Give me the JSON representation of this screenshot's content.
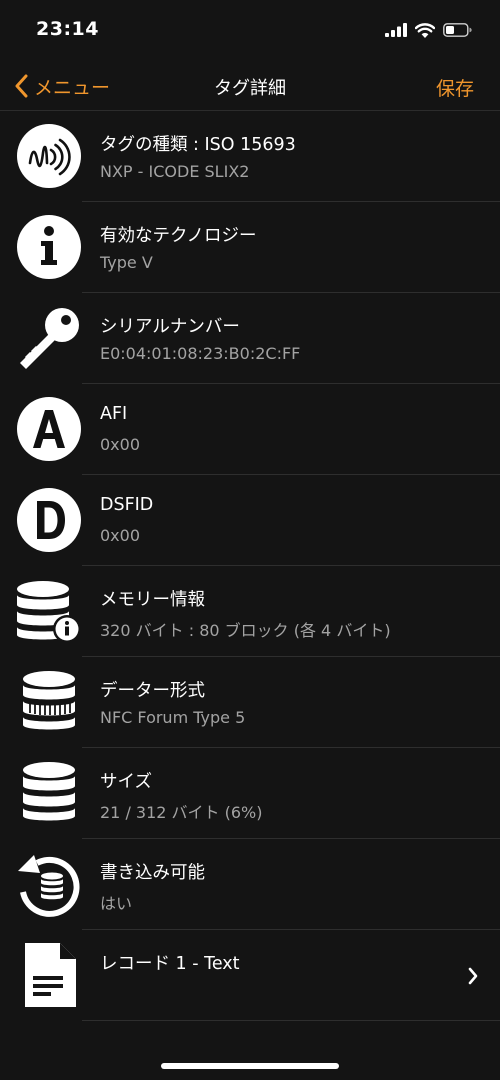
{
  "status": {
    "time": "23:14"
  },
  "nav": {
    "back_label": "メニュー",
    "title": "タグ詳細",
    "save_label": "保存"
  },
  "rows": [
    {
      "icon": "nfc-tag-icon",
      "title": "タグの種類 : ISO 15693",
      "subtitle": "NXP - ICODE SLIX2"
    },
    {
      "icon": "info-icon",
      "title": "有効なテクノロジー",
      "subtitle": "Type V"
    },
    {
      "icon": "key-icon",
      "title": "シリアルナンバー",
      "subtitle": "E0:04:01:08:23:B0:2C:FF"
    },
    {
      "icon": "letter-a-icon",
      "title": "AFI",
      "subtitle": "0x00"
    },
    {
      "icon": "letter-d-icon",
      "title": "DSFID",
      "subtitle": "0x00"
    },
    {
      "icon": "database-info-icon",
      "title": "メモリー情報",
      "subtitle": "320 バイト : 80 ブロック (各 4 バイト)"
    },
    {
      "icon": "database-format-icon",
      "title": "データー形式",
      "subtitle": "NFC Forum Type 5"
    },
    {
      "icon": "database-icon",
      "title": "サイズ",
      "subtitle": "21 / 312 バイト (6%)"
    },
    {
      "icon": "database-refresh-icon",
      "title": "書き込み可能",
      "subtitle": "はい"
    },
    {
      "icon": "document-icon",
      "title": "レコード 1 - Text",
      "subtitle": ""
    }
  ],
  "colors": {
    "accent": "#f0962d",
    "background": "#141414",
    "secondary_text": "#a3a3a3"
  }
}
